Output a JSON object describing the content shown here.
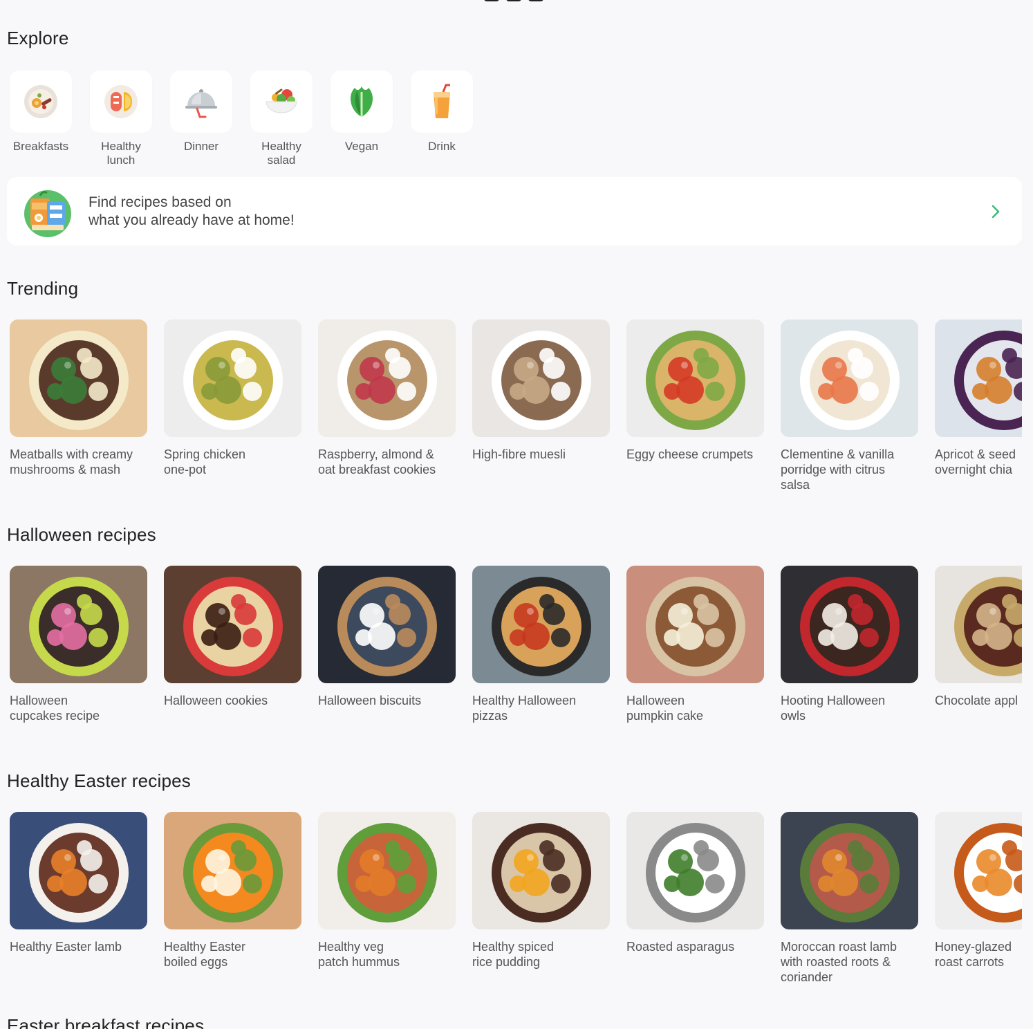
{
  "explore": {
    "title": "Explore",
    "items": [
      {
        "label": "Breakfasts",
        "icon": "breakfast-plate-icon"
      },
      {
        "label": "Healthy\nlunch",
        "icon": "salmon-lemon-icon"
      },
      {
        "label": "Dinner",
        "icon": "cloche-icon"
      },
      {
        "label": "Healthy\nsalad",
        "icon": "salad-bowl-icon"
      },
      {
        "label": "Vegan",
        "icon": "leaf-icon"
      },
      {
        "label": "Drink",
        "icon": "juice-glass-icon"
      }
    ]
  },
  "pantry_banner": {
    "text": "Find recipes based  on\nwhat you already have at home!",
    "icon": "pantry-icon",
    "chevron": "chevron-right-icon",
    "accent": "#3cb878"
  },
  "sections": [
    {
      "title": "Trending",
      "cards": [
        {
          "title": "Meatballs with creamy\nmushrooms & mash",
          "colors": [
            "#e8c9a0",
            "#5a3a2a",
            "#3b7d3a",
            "#f4e9c9"
          ]
        },
        {
          "title": "Spring chicken\none-pot",
          "colors": [
            "#ededed",
            "#c9b94e",
            "#8a9a3a",
            "#ffffff"
          ]
        },
        {
          "title": "Raspberry, almond &\noat breakfast cookies",
          "colors": [
            "#f0ede9",
            "#b8956a",
            "#c0384b",
            "#ffffff"
          ]
        },
        {
          "title": "High-fibre muesli",
          "colors": [
            "#e9e6e3",
            "#8b6a52",
            "#c7a986",
            "#ffffff"
          ]
        },
        {
          "title": "Eggy cheese crumpets",
          "colors": [
            "#ececec",
            "#d9b469",
            "#d43a26",
            "#7ea846"
          ]
        },
        {
          "title": "Clementine & vanilla\nporridge with citrus\nsalsa",
          "colors": [
            "#dfe6ea",
            "#f1e6d4",
            "#e9774a",
            "#ffffff"
          ]
        },
        {
          "title": "Apricot & seed\novernight chia",
          "colors": [
            "#dde3ea",
            "#e3e6ec",
            "#d57e2c",
            "#4a2452"
          ]
        }
      ]
    },
    {
      "title": "Halloween recipes",
      "cards": [
        {
          "title": "Halloween\ncupcakes recipe",
          "colors": [
            "#8b7764",
            "#3a2d2a",
            "#e46fa3",
            "#c6d94a"
          ]
        },
        {
          "title": "Halloween cookies",
          "colors": [
            "#5c3f31",
            "#ead3a2",
            "#3a1e14",
            "#d93a3a"
          ]
        },
        {
          "title": "Halloween biscuits",
          "colors": [
            "#262a35",
            "#3d4a5e",
            "#ffffff",
            "#b98b5b"
          ]
        },
        {
          "title": "Healthy Halloween\npizzas",
          "colors": [
            "#7b8a93",
            "#d9a25a",
            "#c7391f",
            "#2a2a2a"
          ]
        },
        {
          "title": "Halloween\npumpkin cake",
          "colors": [
            "#c98f7c",
            "#8c5a37",
            "#f5efd9",
            "#d8c3a5"
          ]
        },
        {
          "title": "Hooting Halloween\nowls",
          "colors": [
            "#2f2e33",
            "#3b2620",
            "#f2ede4",
            "#c1272d"
          ]
        },
        {
          "title": "Chocolate appl",
          "colors": [
            "#e7e4df",
            "#5a2a20",
            "#d4b489",
            "#c7a96a"
          ]
        }
      ]
    },
    {
      "title": "Healthy Easter recipes",
      "cards": [
        {
          "title": "Healthy Easter lamb",
          "colors": [
            "#3a4e7a",
            "#6b3b2e",
            "#e87f2a",
            "#f4f1ec"
          ]
        },
        {
          "title": "Healthy Easter\nboiled eggs",
          "colors": [
            "#d9a77a",
            "#f3891f",
            "#fff6e0",
            "#6a9a3a"
          ]
        },
        {
          "title": "Healthy veg\npatch hummus",
          "colors": [
            "#f1eeea",
            "#c8643a",
            "#e37b2a",
            "#5f9e3b"
          ]
        },
        {
          "title": "Healthy spiced\nrice pudding",
          "colors": [
            "#eae6e1",
            "#d9c6a9",
            "#f2a51e",
            "#4a2c22"
          ]
        },
        {
          "title": "Roasted asparagus",
          "colors": [
            "#e9e8e6",
            "#ffffff",
            "#3f7d2a",
            "#8a8a8a"
          ]
        },
        {
          "title": "Moroccan roast lamb\nwith roasted roots &\ncoriander",
          "colors": [
            "#3b4450",
            "#b35a4a",
            "#e0872f",
            "#5a7b3a"
          ]
        },
        {
          "title": "Honey-glazed\nroast carrots",
          "colors": [
            "#eeeeee",
            "#ffffff",
            "#ea8a2a",
            "#c65a1a"
          ]
        }
      ]
    },
    {
      "title": "Easter breakfast recipes",
      "cards": []
    }
  ]
}
